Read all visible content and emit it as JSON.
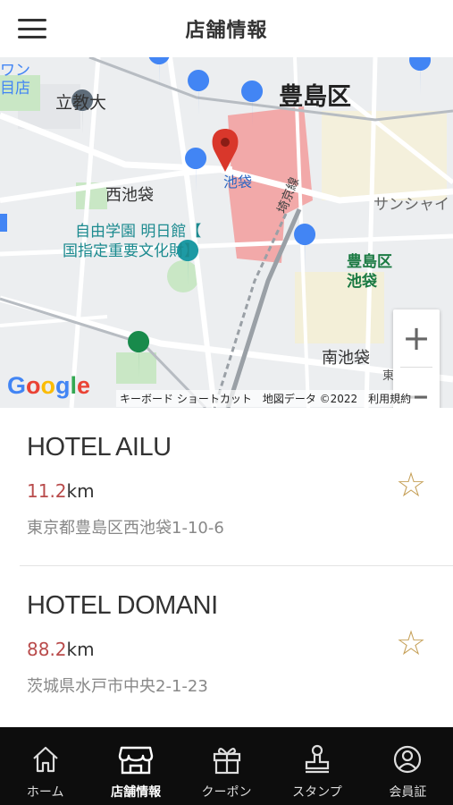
{
  "header": {
    "title": "店舗情報"
  },
  "map": {
    "labels": {
      "toshima_ku": "豊島区",
      "rikkyo": "立教大",
      "nishi_ikebukuro": "西池袋",
      "ikebukuro": "池袋",
      "jiyu_gakuen_1": "自由学園 明日館【",
      "jiyu_gakuen_2": "国指定重要文化財】",
      "saikyo_line": "埼京線",
      "sunshine": "サンシャイ",
      "toshima_ku_office_1": "豊島区",
      "toshima_ku_office_2": "池袋",
      "minami_ikebukuro": "南池袋",
      "top_left_1": "ワン",
      "top_left_2": "目店",
      "higashi": "東通"
    },
    "zoom_in": "+",
    "zoom_out": "−",
    "google": "Google",
    "attribution": "キーボード ショートカット　地図データ ©2022　利用規約",
    "colors": {
      "park": "#c9e7c5",
      "station": "#f2a9a9",
      "road": "#ffffff",
      "pin": "#d9372b",
      "poi_blue": "#4285f4"
    }
  },
  "hotels": [
    {
      "name": "HOTEL AILU",
      "distance": "11.2",
      "unit": "km",
      "address": "東京都豊島区西池袋1-10-6",
      "favorite_icon": "☆"
    },
    {
      "name": "HOTEL DOMANI",
      "distance": "88.2",
      "unit": "km",
      "address": "茨城県水戸市中央2-1-23",
      "favorite_icon": "☆"
    }
  ],
  "tabs": [
    {
      "label": "ホーム",
      "icon": "home-icon",
      "active": false
    },
    {
      "label": "店舗情報",
      "icon": "store-icon",
      "active": true
    },
    {
      "label": "クーポン",
      "icon": "gift-icon",
      "active": false
    },
    {
      "label": "スタンプ",
      "icon": "stamp-icon",
      "active": false
    },
    {
      "label": "会員証",
      "icon": "member-card-icon",
      "active": false
    }
  ],
  "colors": {
    "accent_distance": "#b94b4b",
    "star": "#c6a15a",
    "tabbar": "#0d0d0d"
  }
}
